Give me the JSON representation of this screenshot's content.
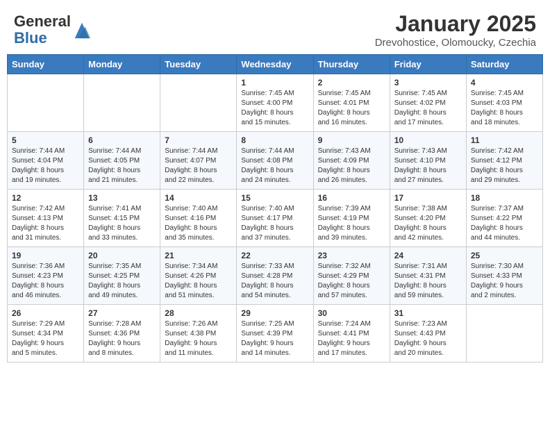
{
  "header": {
    "logo_general": "General",
    "logo_blue": "Blue",
    "month_title": "January 2025",
    "location": "Drevohostice, Olomoucky, Czechia"
  },
  "weekdays": [
    "Sunday",
    "Monday",
    "Tuesday",
    "Wednesday",
    "Thursday",
    "Friday",
    "Saturday"
  ],
  "weeks": [
    [
      {
        "day": "",
        "info": ""
      },
      {
        "day": "",
        "info": ""
      },
      {
        "day": "",
        "info": ""
      },
      {
        "day": "1",
        "info": "Sunrise: 7:45 AM\nSunset: 4:00 PM\nDaylight: 8 hours\nand 15 minutes."
      },
      {
        "day": "2",
        "info": "Sunrise: 7:45 AM\nSunset: 4:01 PM\nDaylight: 8 hours\nand 16 minutes."
      },
      {
        "day": "3",
        "info": "Sunrise: 7:45 AM\nSunset: 4:02 PM\nDaylight: 8 hours\nand 17 minutes."
      },
      {
        "day": "4",
        "info": "Sunrise: 7:45 AM\nSunset: 4:03 PM\nDaylight: 8 hours\nand 18 minutes."
      }
    ],
    [
      {
        "day": "5",
        "info": "Sunrise: 7:44 AM\nSunset: 4:04 PM\nDaylight: 8 hours\nand 19 minutes."
      },
      {
        "day": "6",
        "info": "Sunrise: 7:44 AM\nSunset: 4:05 PM\nDaylight: 8 hours\nand 21 minutes."
      },
      {
        "day": "7",
        "info": "Sunrise: 7:44 AM\nSunset: 4:07 PM\nDaylight: 8 hours\nand 22 minutes."
      },
      {
        "day": "8",
        "info": "Sunrise: 7:44 AM\nSunset: 4:08 PM\nDaylight: 8 hours\nand 24 minutes."
      },
      {
        "day": "9",
        "info": "Sunrise: 7:43 AM\nSunset: 4:09 PM\nDaylight: 8 hours\nand 26 minutes."
      },
      {
        "day": "10",
        "info": "Sunrise: 7:43 AM\nSunset: 4:10 PM\nDaylight: 8 hours\nand 27 minutes."
      },
      {
        "day": "11",
        "info": "Sunrise: 7:42 AM\nSunset: 4:12 PM\nDaylight: 8 hours\nand 29 minutes."
      }
    ],
    [
      {
        "day": "12",
        "info": "Sunrise: 7:42 AM\nSunset: 4:13 PM\nDaylight: 8 hours\nand 31 minutes."
      },
      {
        "day": "13",
        "info": "Sunrise: 7:41 AM\nSunset: 4:15 PM\nDaylight: 8 hours\nand 33 minutes."
      },
      {
        "day": "14",
        "info": "Sunrise: 7:40 AM\nSunset: 4:16 PM\nDaylight: 8 hours\nand 35 minutes."
      },
      {
        "day": "15",
        "info": "Sunrise: 7:40 AM\nSunset: 4:17 PM\nDaylight: 8 hours\nand 37 minutes."
      },
      {
        "day": "16",
        "info": "Sunrise: 7:39 AM\nSunset: 4:19 PM\nDaylight: 8 hours\nand 39 minutes."
      },
      {
        "day": "17",
        "info": "Sunrise: 7:38 AM\nSunset: 4:20 PM\nDaylight: 8 hours\nand 42 minutes."
      },
      {
        "day": "18",
        "info": "Sunrise: 7:37 AM\nSunset: 4:22 PM\nDaylight: 8 hours\nand 44 minutes."
      }
    ],
    [
      {
        "day": "19",
        "info": "Sunrise: 7:36 AM\nSunset: 4:23 PM\nDaylight: 8 hours\nand 46 minutes."
      },
      {
        "day": "20",
        "info": "Sunrise: 7:35 AM\nSunset: 4:25 PM\nDaylight: 8 hours\nand 49 minutes."
      },
      {
        "day": "21",
        "info": "Sunrise: 7:34 AM\nSunset: 4:26 PM\nDaylight: 8 hours\nand 51 minutes."
      },
      {
        "day": "22",
        "info": "Sunrise: 7:33 AM\nSunset: 4:28 PM\nDaylight: 8 hours\nand 54 minutes."
      },
      {
        "day": "23",
        "info": "Sunrise: 7:32 AM\nSunset: 4:29 PM\nDaylight: 8 hours\nand 57 minutes."
      },
      {
        "day": "24",
        "info": "Sunrise: 7:31 AM\nSunset: 4:31 PM\nDaylight: 8 hours\nand 59 minutes."
      },
      {
        "day": "25",
        "info": "Sunrise: 7:30 AM\nSunset: 4:33 PM\nDaylight: 9 hours\nand 2 minutes."
      }
    ],
    [
      {
        "day": "26",
        "info": "Sunrise: 7:29 AM\nSunset: 4:34 PM\nDaylight: 9 hours\nand 5 minutes."
      },
      {
        "day": "27",
        "info": "Sunrise: 7:28 AM\nSunset: 4:36 PM\nDaylight: 9 hours\nand 8 minutes."
      },
      {
        "day": "28",
        "info": "Sunrise: 7:26 AM\nSunset: 4:38 PM\nDaylight: 9 hours\nand 11 minutes."
      },
      {
        "day": "29",
        "info": "Sunrise: 7:25 AM\nSunset: 4:39 PM\nDaylight: 9 hours\nand 14 minutes."
      },
      {
        "day": "30",
        "info": "Sunrise: 7:24 AM\nSunset: 4:41 PM\nDaylight: 9 hours\nand 17 minutes."
      },
      {
        "day": "31",
        "info": "Sunrise: 7:23 AM\nSunset: 4:43 PM\nDaylight: 9 hours\nand 20 minutes."
      },
      {
        "day": "",
        "info": ""
      }
    ]
  ]
}
